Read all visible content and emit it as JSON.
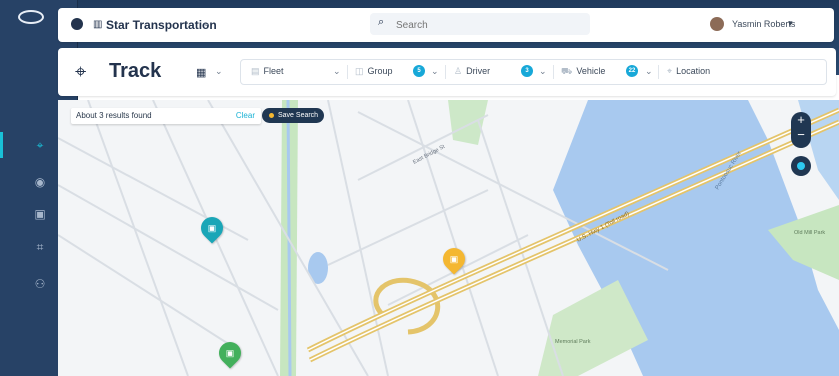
{
  "top_bar": {
    "company": "Star Transportation",
    "user_name": "Yasmin Roberts",
    "search_placeholder": "Search"
  },
  "track_bar": {
    "title": "Track",
    "filters": [
      {
        "label": "Fleet",
        "badge": ""
      },
      {
        "label": "Group",
        "badge": "5"
      },
      {
        "label": "Driver",
        "badge": "3"
      },
      {
        "label": "Vehicle",
        "badge": "22"
      },
      {
        "label": "Location",
        "badge": ""
      }
    ]
  },
  "map_controls": {
    "search_result": "About 3 results found",
    "clear": "Clear",
    "save_search": "Save Search",
    "zoom_in": "+",
    "zoom_out": "−"
  },
  "map_labels": {
    "highway": "U.S. Hwy 1 (Toll road)",
    "street_1": "East Bridge St",
    "river": "Pontoosuc River",
    "park": "Old Mill Park",
    "park_2": "Memorial Park"
  },
  "colors": {
    "sidebar": "#274266",
    "accent": "#19c1d8",
    "marker_teal": "#1aa6b7",
    "marker_yellow": "#f4b731",
    "marker_green": "#43b05c",
    "water": "#a8c9ef"
  },
  "icons": {
    "logo": "oval-logo-icon",
    "track": "location-group-icon",
    "view": "grid-view-icon",
    "search": "search-icon"
  }
}
